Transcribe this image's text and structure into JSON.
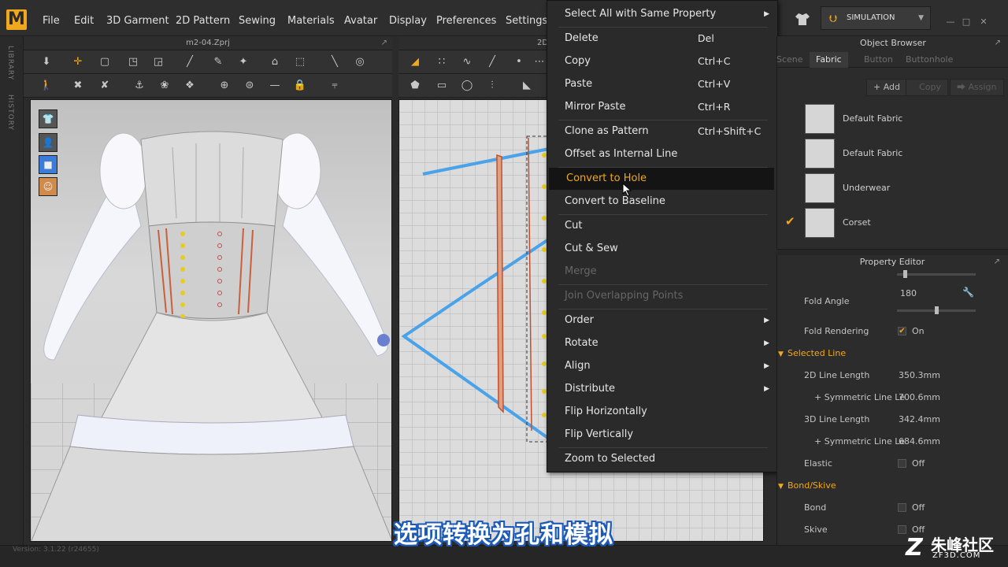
{
  "app": {
    "logo": "M"
  },
  "menubar": {
    "items": [
      "File",
      "Edit",
      "3D Garment",
      "2D Pattern",
      "Sewing",
      "Materials",
      "Avatar",
      "Display",
      "Preferences",
      "Settings"
    ],
    "simulation_label": "SIMULATION"
  },
  "left_strip": {
    "library": "LIBRARY",
    "history": "HISTORY"
  },
  "panel3d": {
    "title": "m2-04.Zprj"
  },
  "panel2d": {
    "title": "2D"
  },
  "context_menu": {
    "items": [
      {
        "label": "Select All with Same Property",
        "shortcut": "",
        "submenu": true
      },
      {
        "label": "Delete",
        "shortcut": "Del"
      },
      {
        "label": "Copy",
        "shortcut": "Ctrl+C"
      },
      {
        "label": "Paste",
        "shortcut": "Ctrl+V"
      },
      {
        "label": "Mirror Paste",
        "shortcut": "Ctrl+R"
      },
      {
        "label": "Clone as Pattern",
        "shortcut": "Ctrl+Shift+C"
      },
      {
        "label": "Offset as Internal Line",
        "shortcut": ""
      },
      {
        "label": "Convert to Hole",
        "shortcut": "",
        "hover": true
      },
      {
        "label": "Convert to Baseline",
        "shortcut": ""
      },
      {
        "label": "Cut",
        "shortcut": ""
      },
      {
        "label": "Cut & Sew",
        "shortcut": ""
      },
      {
        "label": "Merge",
        "shortcut": "",
        "disabled": true
      },
      {
        "label": "Join Overlapping Points",
        "shortcut": "",
        "disabled": true
      },
      {
        "label": "Order",
        "submenu": true
      },
      {
        "label": "Rotate",
        "submenu": true
      },
      {
        "label": "Align",
        "submenu": true
      },
      {
        "label": "Distribute",
        "submenu": true
      },
      {
        "label": "Flip Horizontally"
      },
      {
        "label": "Flip Vertically"
      },
      {
        "label": "Zoom to Selected"
      }
    ]
  },
  "object_browser": {
    "title": "Object Browser",
    "tabs": [
      "Scene",
      "Fabric",
      "Button",
      "Buttonhole"
    ],
    "active_tab": "Fabric",
    "buttons": {
      "add": "Add",
      "copy": "Copy",
      "assign": "Assign"
    },
    "fabrics": [
      {
        "name": "Default Fabric",
        "checked": false
      },
      {
        "name": "Default Fabric",
        "checked": false
      },
      {
        "name": "Underwear",
        "checked": false
      },
      {
        "name": "Corset",
        "checked": true
      }
    ]
  },
  "property_editor": {
    "title": "Property Editor",
    "fold_angle": {
      "label": "Fold Angle",
      "value": "180"
    },
    "fold_rendering": {
      "label": "Fold Rendering",
      "value": "On"
    },
    "selected_line": {
      "title": "Selected Line",
      "line2d": {
        "label": "2D Line Length",
        "value": "350.3mm"
      },
      "sym2d": {
        "label": "+ Symmetric Line Le",
        "value": "700.6mm"
      },
      "line3d": {
        "label": "3D Line Length",
        "value": "342.4mm"
      },
      "sym3d": {
        "label": "+ Symmetric Line Le",
        "value": "684.6mm"
      },
      "elastic": {
        "label": "Elastic",
        "value": "Off"
      }
    },
    "bond_skive": {
      "title": "Bond/Skive",
      "bond": {
        "label": "Bond",
        "value": "Off"
      },
      "skive": {
        "label": "Skive",
        "value": "Off"
      }
    }
  },
  "status": {
    "version": "Version: 3.1.22    (r24655)"
  },
  "overlay": {
    "subtitle": "选项转换为孔和模拟",
    "wm_big": "朱峰社区",
    "wm_small": "ZF3D.COM",
    "wm_z": "Z"
  },
  "colors": {
    "accent": "#f2a81d",
    "pattern_line": "#4aa3e8"
  }
}
